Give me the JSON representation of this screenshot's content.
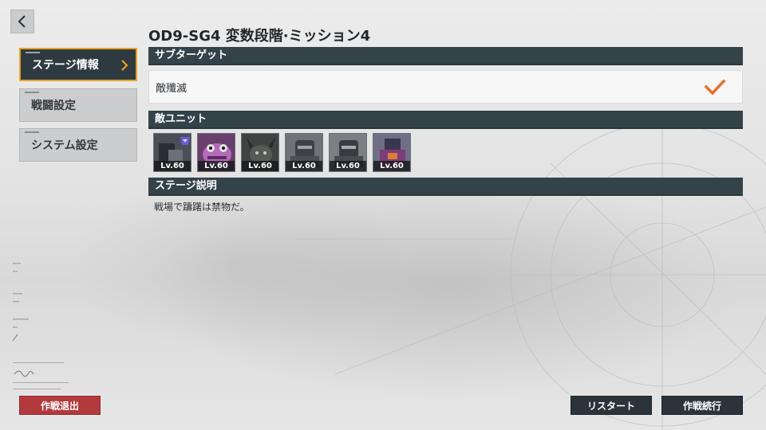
{
  "header": {
    "title": "OD9-SG4 変数段階·ミッション4"
  },
  "sidebar": {
    "items": [
      {
        "label": "ステージ情報",
        "active": true
      },
      {
        "label": "戦闘設定",
        "active": false
      },
      {
        "label": "システム設定",
        "active": false
      }
    ]
  },
  "sections": {
    "sub_target_header": "サブターゲット",
    "sub_target": {
      "text": "敵殲滅",
      "completed": true
    },
    "enemy_units_header": "敵ユニット",
    "enemy_units": [
      {
        "level": "Lv.60"
      },
      {
        "level": "Lv.60"
      },
      {
        "level": "Lv.60"
      },
      {
        "level": "Lv.60"
      },
      {
        "level": "Lv.60"
      },
      {
        "level": "Lv.60"
      }
    ],
    "stage_description_header": "ステージ説明",
    "stage_description": "戦場で躊躇は禁物だ。"
  },
  "buttons": {
    "exit": "作戦退出",
    "restart": "リスタート",
    "continue": "作戦続行"
  },
  "colors": {
    "accent": "#e6a326",
    "check": "#e9702a",
    "header_bar": "#34434a",
    "exit_button": "#b23a3d",
    "dark_button": "#2a343a"
  },
  "icons": {
    "back": "chevron-left-icon",
    "active_item": "chevron-right-icon",
    "completed": "checkmark-icon"
  }
}
